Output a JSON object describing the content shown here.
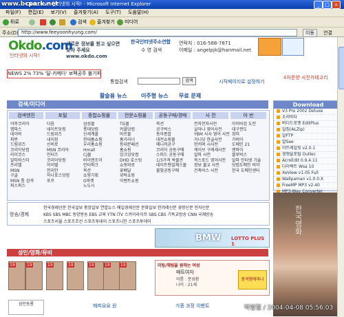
{
  "window": {
    "title": "Okdo.com 인터넷의 시작! - Microsoft Internet Explorer",
    "watermark": "www.bcpark.net"
  },
  "menu": [
    "파일(F)",
    "편집(E)",
    "보기(V)",
    "즐겨찾기(A)",
    "도구(T)",
    "도움말(H)"
  ],
  "toolbar": {
    "back": "뒤로",
    "search": "검색",
    "favorites": "즐겨찾기",
    "media": "미디어"
  },
  "address": {
    "label": "주소(D)",
    "url": "http://www.feeyoonhyung.com/",
    "go": "이동",
    "links": "연결"
  },
  "header": {
    "logo_main": "Okdo",
    "logo_dot": ".com",
    "tagline": "인터넷의 시작!",
    "promo": "새로운 정보를 원고 싶으면 찾아 주세요 www.okdo.com",
    "cust_title": "한국인터넷주소연합",
    "cust_line1": "수  영   검색",
    "contact_label": "연락처 : 016-588-7871",
    "email_label": "이메일 : angelpjk@hanmail.net"
  },
  "newsbar": {
    "text": "NEWS 2% 73%  '달-카메다' 보팩공주 불기피 ▶이"
  },
  "search": {
    "label": "통합검색",
    "button": "검색",
    "homepage_link": "시작페이지로 설정하기",
    "ad_text": "4차문양 사전카테고리"
  },
  "nav": {
    "left": "활술용 뉴스",
    "center": "이주형 뉴스",
    "right": "무료 문제"
  },
  "category": {
    "header": "검색/미디어",
    "columns": [
      {
        "title": "검색엔진",
        "items": [
          "야후코리아",
          "엠파스",
          "네이버",
          "파란",
          "드림위즈",
          "코리아닷컴",
          "라이코스",
          "알타비스타",
          "프리챌",
          "MSN",
          "구글",
          "MSN 통 검색",
          "파스파스"
        ]
      },
      {
        "title": "포털",
        "items": [
          "다음",
          "네이트닷컴",
          "드림위즈",
          "내이장",
          "신비로",
          "MSN 코리아",
          "인터즈",
          "코리아닷컴",
          "하이텔",
          "천리안",
          "하나포스닷컴",
          "포프"
        ]
      },
      {
        "title": "종합쇼핑몰",
        "items": [
          "삼성몰",
          "롯데닷컴",
          "신세계몰",
          "현대홈쇼핑",
          "우리홈쇼핑",
          "Hmall",
          "CJ몰",
          "바이엔조이",
          "인터파크",
          "옥션",
          "쇼핑기획",
          "G마켓",
          "노도시"
        ]
      },
      {
        "title": "전문쇼핑몰",
        "items": [
          "TG몰",
          "커플닷컴",
          "마르몰",
          "홈가리너",
          "동대문패션",
          "홈쇼핑",
          "잉크잉닷컴",
          "DHD 호스팅",
          "쇼핑와로",
          "꽃배달",
          "위탁쇼핑",
          "이벤트쇼핑"
        ]
      },
      {
        "title": "공동구매/경매",
        "items": [
          "옥션",
          "공구박스",
          "동아종합",
          "대전쇼핑몰",
          "매니저공구",
          "코리아 공동구매",
          "스피드 공동구매",
          "1/3가격 박물관",
          "데이트맨걸체스몰",
          "불빛공동구매"
        ]
      },
      {
        "title": "사 전",
        "items": [
          "전자전자사전",
          "살아나 영어사전",
          "YBM 사사 영어 사전",
          "거니닷 한글사전",
          "한키며 시사전",
          "케이브 구레세사전",
          "알파 사전",
          "옥스포드 영어사전",
          "정보 불교 사전",
          "건축어스 사전"
        ]
      },
      {
        "title": "아 반",
        "items": [
          "아이바검 도전",
          "대구권도",
          "희미",
          "가비아",
          "도메인 21",
          "엔파이",
          "블루박스",
          "알파 인터넷 기술",
          "닷컴도메인 비야",
          "한국 도메인센터"
        ]
      }
    ]
  },
  "press": {
    "label": "방송/경제",
    "line1": "한국경제신문  한국일보  중앙일보  연합뉴스  매일경제신문  문화일보  한겨레신문  경향신문  전자신문",
    "line2": "KBS  SBS  MBC  동양방송  EBS  교육  YTN  iTV  스카이라이프  SBS  CBS 기독교방송  CNN 국제방송",
    "line3": "스포츠서울  스포츠조선  스포츠투데이  스포츠니안  스포츠투데이"
  },
  "banner": {
    "text": "BMW",
    "subtext": "LOTTO PLUS 1"
  },
  "adult": {
    "header": "성인/영화/뮤비",
    "badges": [
      "19",
      "19",
      "19",
      "19",
      "19",
      "19",
      "19"
    ],
    "ad_title": "미팅/채팅을 원하는 여성",
    "ad_sub": "매트여자",
    "ad_badge": "충격잼에마나",
    "profile_name": "이름 : 문성환",
    "profile_age": "나이 : 21세"
  },
  "download": {
    "header": "Download",
    "items": [
      "V3 Pro 2002 Deluxe",
      "소리바다",
      "버디드로켓 EditPlus",
      "알집(ALZip)",
      "알FTP",
      "알See",
      "이트레일빗 v2.0.1",
      "경쟁을포털 Outlec",
      "AcroEdit 0.9.4.11",
      "다이렉트 Wsa 10",
      "XeView v1.05 Full",
      "Wallpaman v1.0.0.X",
      "FreeMP MP3 v2.40",
      "MP3-Wav Converter"
    ]
  },
  "photo": {
    "stamp": "박형철 / 2004-04-08 05:56:03",
    "caption": "한국영화"
  },
  "footer": {
    "left_label": "성인동룡",
    "mid_label": "해피요요 원",
    "right_label": "가중 과정 이벤트"
  }
}
